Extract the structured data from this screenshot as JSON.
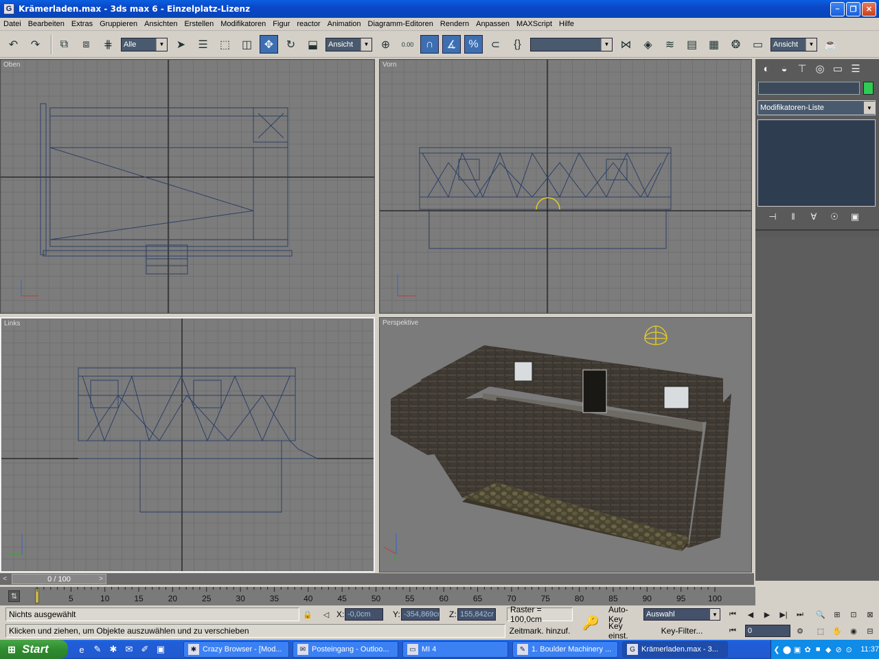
{
  "window": {
    "title": "Krämerladen.max - 3ds max 6 - Einzelplatz-Lizenz",
    "minimize": "–",
    "maximize": "❐",
    "close": "✕"
  },
  "menu": [
    "Datei",
    "Bearbeiten",
    "Extras",
    "Gruppieren",
    "Ansichten",
    "Erstellen",
    "Modifikatoren",
    "Figur",
    "reactor",
    "Animation",
    "Diagramm-Editoren",
    "Rendern",
    "Anpassen",
    "MAXScript",
    "Hilfe"
  ],
  "toolbar": {
    "selection_filter": "Alle",
    "ref_coord": "Ansicht",
    "spinner_snap": "0.00",
    "named_selection": "",
    "view_combo": "Ansicht"
  },
  "viewports": {
    "top": "Oben",
    "front": "Vorn",
    "left": "Links",
    "perspective": "Perspektive"
  },
  "command_panel": {
    "object_name": "",
    "object_color": "#2ecc55",
    "modifier_list": "Modifikatoren-Liste"
  },
  "timeline": {
    "slider_label": "0 / 100",
    "ticks": [
      "5",
      "10",
      "15",
      "20",
      "25",
      "30",
      "35",
      "40",
      "45",
      "50",
      "55",
      "60",
      "65",
      "70",
      "75",
      "80",
      "85",
      "90",
      "95",
      "100"
    ]
  },
  "status": {
    "selection": "Nichts ausgewählt",
    "prompt": "Klicken und ziehen, um Objekte auszuwählen und zu verschieben",
    "x_label": "X:",
    "x_value": "-0,0cm",
    "y_label": "Y:",
    "y_value": "-354,869cr",
    "z_label": "Z:",
    "z_value": "155,842cr",
    "grid": "Raster = 100,0cm",
    "time_tag": "Zeitmark. hinzuf.",
    "auto_key": "Auto-Key",
    "set_key": "Key einst.",
    "key_mode": "Auswahl",
    "key_filter": "Key-Filter...",
    "frame": "0"
  },
  "taskbar": {
    "start": "Start",
    "tasks": [
      "Crazy Browser - [Mod...",
      "Posteingang - Outloo...",
      "MI 4",
      "1. Boulder Machinery ...",
      "Krämerladen.max - 3..."
    ],
    "clock": "11:37"
  }
}
